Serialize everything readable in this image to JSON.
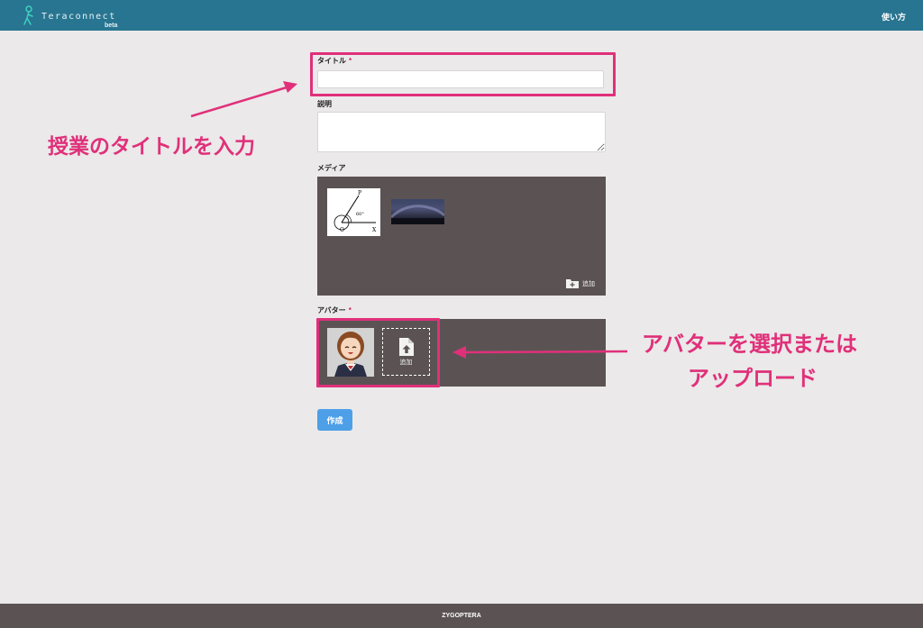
{
  "header": {
    "app_name": "Teraconnect",
    "badge": "beta",
    "help_link": "使い方",
    "bg_color": "#287591"
  },
  "form": {
    "title_label": "タイトル",
    "required_mark": "*",
    "title_value": "",
    "description_label": "説明",
    "description_value": "",
    "media_label": "メディア",
    "media_add_label": "追加",
    "media_items": [
      {
        "type": "image",
        "alt": "angle diagram",
        "labels": [
          "P",
          "60°",
          "O",
          "X"
        ]
      },
      {
        "type": "image",
        "alt": "night sky"
      }
    ],
    "avatar_label": "アバター",
    "avatar_add_label": "追加",
    "create_button": "作成",
    "button_color": "#4d9fe8",
    "panel_color": "#5b5353"
  },
  "annotations": {
    "title_hint": "授業のタイトルを入力",
    "avatar_hint_line1": "アバターを選択または",
    "avatar_hint_line2": "アップロード",
    "color": "#e0307a"
  },
  "footer": {
    "text": "ZYGOPTERA"
  }
}
